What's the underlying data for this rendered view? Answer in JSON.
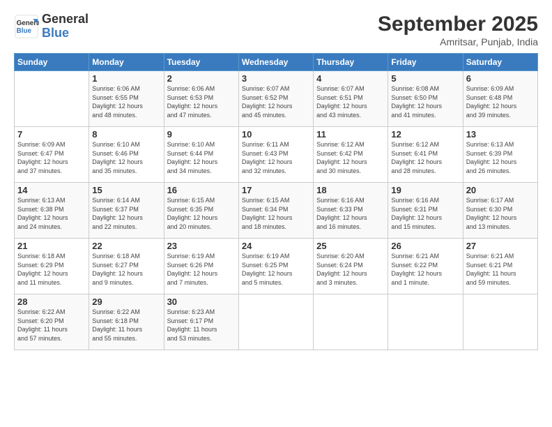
{
  "header": {
    "logo_general": "General",
    "logo_blue": "Blue",
    "month_title": "September 2025",
    "location": "Amritsar, Punjab, India"
  },
  "weekdays": [
    "Sunday",
    "Monday",
    "Tuesday",
    "Wednesday",
    "Thursday",
    "Friday",
    "Saturday"
  ],
  "weeks": [
    [
      {
        "day": "",
        "info": ""
      },
      {
        "day": "1",
        "info": "Sunrise: 6:06 AM\nSunset: 6:55 PM\nDaylight: 12 hours\nand 48 minutes."
      },
      {
        "day": "2",
        "info": "Sunrise: 6:06 AM\nSunset: 6:53 PM\nDaylight: 12 hours\nand 47 minutes."
      },
      {
        "day": "3",
        "info": "Sunrise: 6:07 AM\nSunset: 6:52 PM\nDaylight: 12 hours\nand 45 minutes."
      },
      {
        "day": "4",
        "info": "Sunrise: 6:07 AM\nSunset: 6:51 PM\nDaylight: 12 hours\nand 43 minutes."
      },
      {
        "day": "5",
        "info": "Sunrise: 6:08 AM\nSunset: 6:50 PM\nDaylight: 12 hours\nand 41 minutes."
      },
      {
        "day": "6",
        "info": "Sunrise: 6:09 AM\nSunset: 6:48 PM\nDaylight: 12 hours\nand 39 minutes."
      }
    ],
    [
      {
        "day": "7",
        "info": "Sunrise: 6:09 AM\nSunset: 6:47 PM\nDaylight: 12 hours\nand 37 minutes."
      },
      {
        "day": "8",
        "info": "Sunrise: 6:10 AM\nSunset: 6:46 PM\nDaylight: 12 hours\nand 35 minutes."
      },
      {
        "day": "9",
        "info": "Sunrise: 6:10 AM\nSunset: 6:44 PM\nDaylight: 12 hours\nand 34 minutes."
      },
      {
        "day": "10",
        "info": "Sunrise: 6:11 AM\nSunset: 6:43 PM\nDaylight: 12 hours\nand 32 minutes."
      },
      {
        "day": "11",
        "info": "Sunrise: 6:12 AM\nSunset: 6:42 PM\nDaylight: 12 hours\nand 30 minutes."
      },
      {
        "day": "12",
        "info": "Sunrise: 6:12 AM\nSunset: 6:41 PM\nDaylight: 12 hours\nand 28 minutes."
      },
      {
        "day": "13",
        "info": "Sunrise: 6:13 AM\nSunset: 6:39 PM\nDaylight: 12 hours\nand 26 minutes."
      }
    ],
    [
      {
        "day": "14",
        "info": "Sunrise: 6:13 AM\nSunset: 6:38 PM\nDaylight: 12 hours\nand 24 minutes."
      },
      {
        "day": "15",
        "info": "Sunrise: 6:14 AM\nSunset: 6:37 PM\nDaylight: 12 hours\nand 22 minutes."
      },
      {
        "day": "16",
        "info": "Sunrise: 6:15 AM\nSunset: 6:35 PM\nDaylight: 12 hours\nand 20 minutes."
      },
      {
        "day": "17",
        "info": "Sunrise: 6:15 AM\nSunset: 6:34 PM\nDaylight: 12 hours\nand 18 minutes."
      },
      {
        "day": "18",
        "info": "Sunrise: 6:16 AM\nSunset: 6:33 PM\nDaylight: 12 hours\nand 16 minutes."
      },
      {
        "day": "19",
        "info": "Sunrise: 6:16 AM\nSunset: 6:31 PM\nDaylight: 12 hours\nand 15 minutes."
      },
      {
        "day": "20",
        "info": "Sunrise: 6:17 AM\nSunset: 6:30 PM\nDaylight: 12 hours\nand 13 minutes."
      }
    ],
    [
      {
        "day": "21",
        "info": "Sunrise: 6:18 AM\nSunset: 6:29 PM\nDaylight: 12 hours\nand 11 minutes."
      },
      {
        "day": "22",
        "info": "Sunrise: 6:18 AM\nSunset: 6:27 PM\nDaylight: 12 hours\nand 9 minutes."
      },
      {
        "day": "23",
        "info": "Sunrise: 6:19 AM\nSunset: 6:26 PM\nDaylight: 12 hours\nand 7 minutes."
      },
      {
        "day": "24",
        "info": "Sunrise: 6:19 AM\nSunset: 6:25 PM\nDaylight: 12 hours\nand 5 minutes."
      },
      {
        "day": "25",
        "info": "Sunrise: 6:20 AM\nSunset: 6:24 PM\nDaylight: 12 hours\nand 3 minutes."
      },
      {
        "day": "26",
        "info": "Sunrise: 6:21 AM\nSunset: 6:22 PM\nDaylight: 12 hours\nand 1 minute."
      },
      {
        "day": "27",
        "info": "Sunrise: 6:21 AM\nSunset: 6:21 PM\nDaylight: 11 hours\nand 59 minutes."
      }
    ],
    [
      {
        "day": "28",
        "info": "Sunrise: 6:22 AM\nSunset: 6:20 PM\nDaylight: 11 hours\nand 57 minutes."
      },
      {
        "day": "29",
        "info": "Sunrise: 6:22 AM\nSunset: 6:18 PM\nDaylight: 11 hours\nand 55 minutes."
      },
      {
        "day": "30",
        "info": "Sunrise: 6:23 AM\nSunset: 6:17 PM\nDaylight: 11 hours\nand 53 minutes."
      },
      {
        "day": "",
        "info": ""
      },
      {
        "day": "",
        "info": ""
      },
      {
        "day": "",
        "info": ""
      },
      {
        "day": "",
        "info": ""
      }
    ]
  ]
}
